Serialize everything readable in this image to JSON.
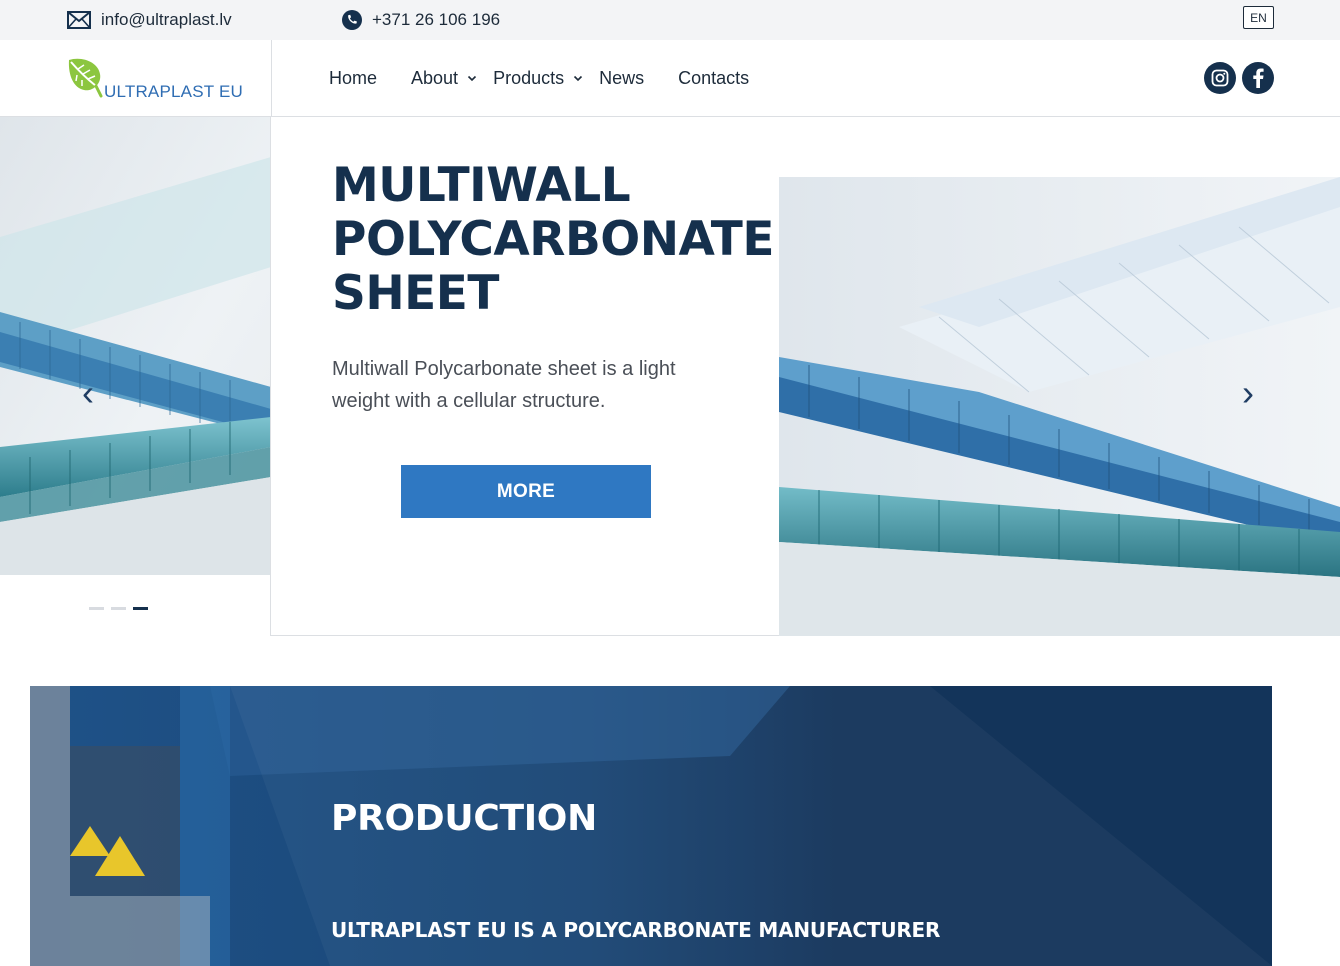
{
  "topbar": {
    "email": "info@ultraplast.lv",
    "phone": "+371 26 106 196",
    "language": "EN",
    "icons": {
      "email": "envelope-icon",
      "phone": "phone-icon"
    }
  },
  "header": {
    "logo_text": "ULTRAPLAST EU",
    "nav": [
      {
        "label": "Home",
        "dropdown": false
      },
      {
        "label": "About",
        "dropdown": true
      },
      {
        "label": "Products",
        "dropdown": true
      },
      {
        "label": "News",
        "dropdown": false
      },
      {
        "label": "Contacts",
        "dropdown": false
      }
    ],
    "social": [
      "instagram-icon",
      "facebook-icon"
    ]
  },
  "hero": {
    "title_lines": [
      "MULTIWALL",
      "POLYCARBONATE",
      "SHEET"
    ],
    "text": "Multiwall Polycarbonate sheet is a light weight with a cellular structure.",
    "button_label": "MORE",
    "prev_arrow": "‹",
    "next_arrow": "›",
    "slides_total": 3,
    "slide_active": 3
  },
  "production": {
    "title": "PRODUCTION",
    "subtitle": "ULTRAPLAST EU IS A POLYCARBONATE MANUFACTURER"
  },
  "colors": {
    "navy": "#15304d",
    "button_blue": "#2f78c2",
    "logo_blue": "#2f6db3",
    "logo_green": "#8cc63f",
    "topbar_bg": "#f3f4f6"
  }
}
